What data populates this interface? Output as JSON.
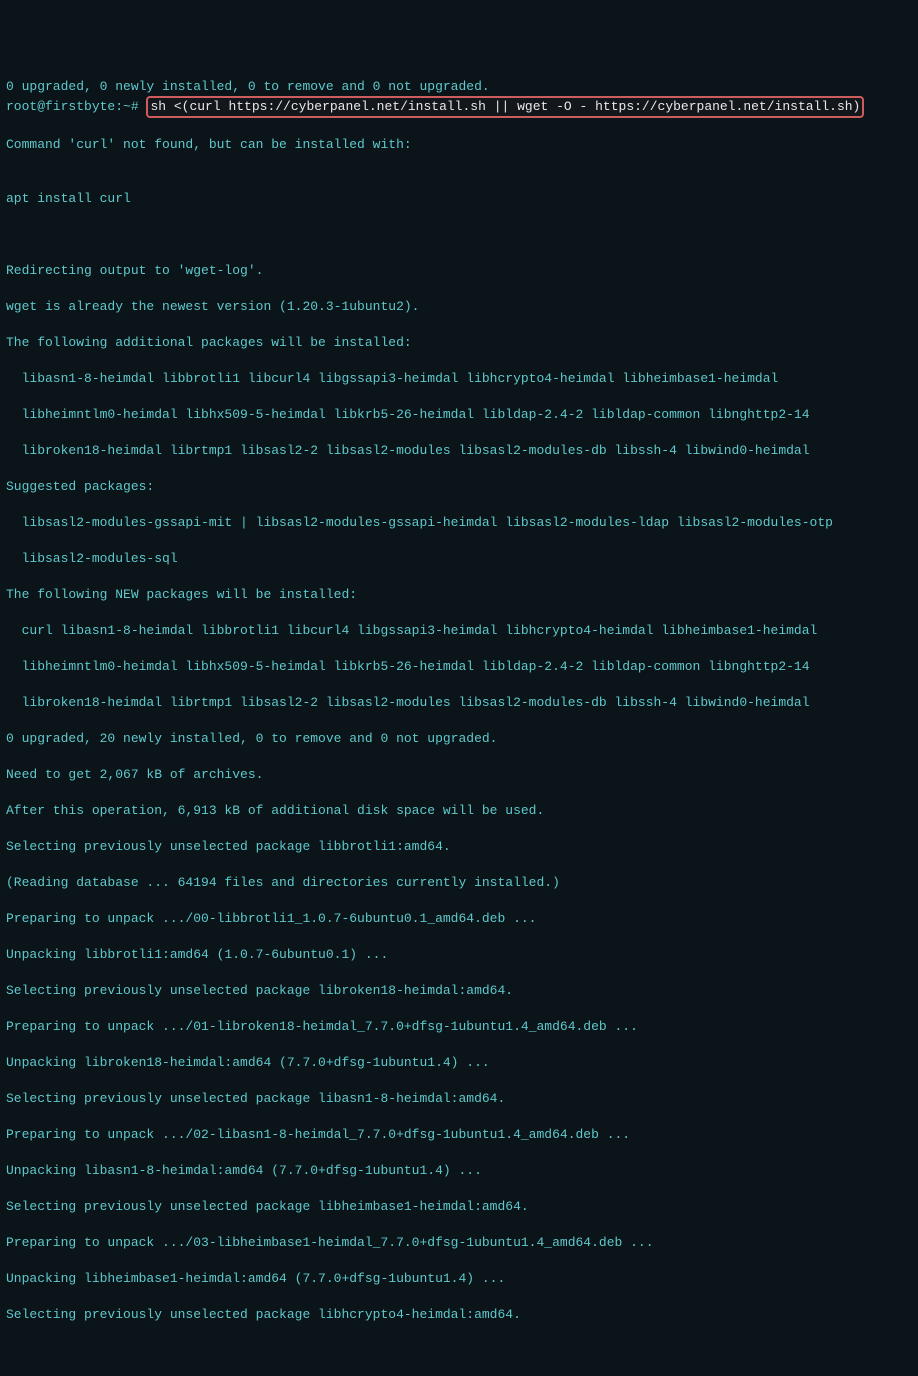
{
  "lines": {
    "l1": "0 upgraded, 0 newly installed, 0 to remove and 0 not upgraded.",
    "prompt": "root@firstbyte:~# ",
    "cmd": "sh <(curl https://cyberpanel.net/install.sh || wget -O - https://cyberpanel.net/install.sh)",
    "l3": "",
    "l4": "Command 'curl' not found, but can be installed with:",
    "l5": "",
    "l6": "apt install curl",
    "l7": "",
    "l8": "",
    "l9": "Redirecting output to 'wget-log'.",
    "l10": "wget is already the newest version (1.20.3-1ubuntu2).",
    "l11": "The following additional packages will be installed:",
    "l12": "  libasn1-8-heimdal libbrotli1 libcurl4 libgssapi3-heimdal libhcrypto4-heimdal libheimbase1-heimdal",
    "l13": "  libheimntlm0-heimdal libhx509-5-heimdal libkrb5-26-heimdal libldap-2.4-2 libldap-common libnghttp2-14",
    "l14": "  libroken18-heimdal librtmp1 libsasl2-2 libsasl2-modules libsasl2-modules-db libssh-4 libwind0-heimdal",
    "l15": "Suggested packages:",
    "l16": "  libsasl2-modules-gssapi-mit | libsasl2-modules-gssapi-heimdal libsasl2-modules-ldap libsasl2-modules-otp",
    "l17": "  libsasl2-modules-sql",
    "l18": "The following NEW packages will be installed:",
    "l19": "  curl libasn1-8-heimdal libbrotli1 libcurl4 libgssapi3-heimdal libhcrypto4-heimdal libheimbase1-heimdal",
    "l20": "  libheimntlm0-heimdal libhx509-5-heimdal libkrb5-26-heimdal libldap-2.4-2 libldap-common libnghttp2-14",
    "l21": "  libroken18-heimdal librtmp1 libsasl2-2 libsasl2-modules libsasl2-modules-db libssh-4 libwind0-heimdal",
    "l22": "0 upgraded, 20 newly installed, 0 to remove and 0 not upgraded.",
    "l23": "Need to get 2,067 kB of archives.",
    "l24": "After this operation, 6,913 kB of additional disk space will be used.",
    "l25": "Selecting previously unselected package libbrotli1:amd64.",
    "l26": "(Reading database ... 64194 files and directories currently installed.)",
    "l27": "Preparing to unpack .../00-libbrotli1_1.0.7-6ubuntu0.1_amd64.deb ...",
    "l28": "Unpacking libbrotli1:amd64 (1.0.7-6ubuntu0.1) ...",
    "l29": "Selecting previously unselected package libroken18-heimdal:amd64.",
    "l30": "Preparing to unpack .../01-libroken18-heimdal_7.7.0+dfsg-1ubuntu1.4_amd64.deb ...",
    "l31": "Unpacking libroken18-heimdal:amd64 (7.7.0+dfsg-1ubuntu1.4) ...",
    "l32": "Selecting previously unselected package libasn1-8-heimdal:amd64.",
    "l33": "Preparing to unpack .../02-libasn1-8-heimdal_7.7.0+dfsg-1ubuntu1.4_amd64.deb ...",
    "l34": "Unpacking libasn1-8-heimdal:amd64 (7.7.0+dfsg-1ubuntu1.4) ...",
    "l35": "Selecting previously unselected package libheimbase1-heimdal:amd64.",
    "l36": "Preparing to unpack .../03-libheimbase1-heimdal_7.7.0+dfsg-1ubuntu1.4_amd64.deb ...",
    "l37": "Unpacking libheimbase1-heimdal:amd64 (7.7.0+dfsg-1ubuntu1.4) ...",
    "l38": "Selecting previously unselected package libhcrypto4-heimdal:amd64."
  }
}
